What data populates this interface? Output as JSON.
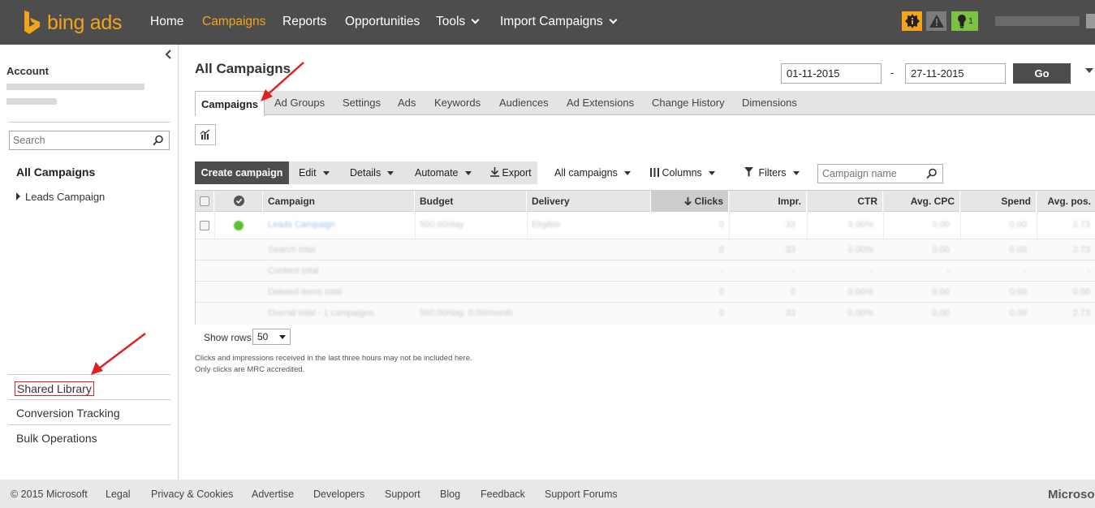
{
  "header": {
    "logo_text": "bing ads",
    "nav": [
      {
        "label": "Home",
        "active": false
      },
      {
        "label": "Campaigns",
        "active": true
      },
      {
        "label": "Reports",
        "active": false
      },
      {
        "label": "Opportunities",
        "active": false
      },
      {
        "label": "Tools",
        "active": false
      },
      {
        "label": "Import Campaigns",
        "active": false
      }
    ],
    "bulb_count": "1"
  },
  "sidebar": {
    "account_label": "Account",
    "search_placeholder": "Search",
    "all_campaigns": "All Campaigns",
    "leads_campaign": "Leads Campaign",
    "links": [
      "Shared Library",
      "Conversion Tracking",
      "Bulk Operations"
    ]
  },
  "main": {
    "title": "All Campaigns",
    "date_from": "01-11-2015",
    "date_sep": "-",
    "date_to": "27-11-2015",
    "go_label": "Go",
    "tabs": [
      "Campaigns",
      "Ad Groups",
      "Settings",
      "Ads",
      "Keywords",
      "Audiences",
      "Ad Extensions",
      "Change History",
      "Dimensions"
    ],
    "toolbar": {
      "create": "Create campaign",
      "edit": "Edit",
      "details": "Details",
      "automate": "Automate",
      "export": "Export",
      "all_campaigns": "All campaigns",
      "columns": "Columns",
      "filters": "Filters",
      "search_placeholder": "Campaign name"
    },
    "grid": {
      "columns": [
        "Campaign",
        "Budget",
        "Delivery",
        "Clicks",
        "Impr.",
        "CTR",
        "Avg. CPC",
        "Spend",
        "Avg. pos."
      ],
      "rows": [
        {
          "campaign": "Leads Campaign",
          "budget": "500.00/day",
          "delivery": "Eligible",
          "clicks": "0",
          "impr": "33",
          "ctr": "0.00%",
          "cpc": "0.00",
          "spend": "0.00",
          "pos": "2.73"
        },
        {
          "campaign": "Search total",
          "budget": "",
          "delivery": "",
          "clicks": "0",
          "impr": "33",
          "ctr": "0.00%",
          "cpc": "0.00",
          "spend": "0.00",
          "pos": "2.73"
        },
        {
          "campaign": "Content total",
          "budget": "",
          "delivery": "",
          "clicks": "-",
          "impr": "-",
          "ctr": "-",
          "cpc": "-",
          "spend": "-",
          "pos": "-"
        },
        {
          "campaign": "Deleted items total",
          "budget": "",
          "delivery": "",
          "clicks": "0",
          "impr": "0",
          "ctr": "0.00%",
          "cpc": "0.00",
          "spend": "0.00",
          "pos": "0.00"
        },
        {
          "campaign": "Overall total - 1 campaigns",
          "budget": "500.00/day, 0.00/month",
          "delivery": "",
          "clicks": "0",
          "impr": "33",
          "ctr": "0.00%",
          "cpc": "0.00",
          "spend": "0.00",
          "pos": "2.73"
        }
      ]
    },
    "show_rows_label": "Show rows:",
    "show_rows_value": "50",
    "note1": "Clicks and impressions received in the last three hours may not be included here.",
    "note2": "Only clicks are MRC accredited."
  },
  "footer": {
    "links": [
      "© 2015 Microsoft",
      "Legal",
      "Privacy & Cookies",
      "Advertise",
      "Developers",
      "Support",
      "Blog",
      "Feedback",
      "Support Forums"
    ],
    "brand": "Microsoft"
  },
  "colors": {
    "accent": "#f2a51a",
    "topbar": "#4d4d4d",
    "annotation": "#e02020",
    "status_green": "#59c22e"
  }
}
